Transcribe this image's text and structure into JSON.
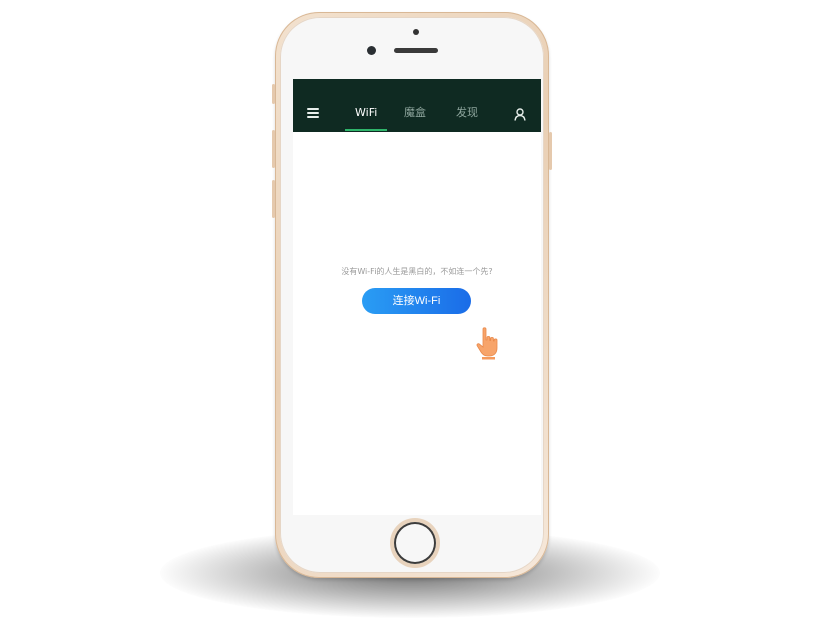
{
  "nav": {
    "tabs": [
      {
        "label": "WiFi",
        "active": true
      },
      {
        "label": "魔盒",
        "active": false
      },
      {
        "label": "发现",
        "active": false
      }
    ],
    "menu_icon": "hamburger-menu-icon",
    "user_icon": "user-profile-icon"
  },
  "main": {
    "hint": "没有Wi-Fi的人生是黑白的，不如连一个先?",
    "connect_button_label": "连接Wi-Fi"
  },
  "colors": {
    "topbar_bg": "#0f2a22",
    "tab_active": "#ffffff",
    "tab_inactive": "#8ea59d",
    "tab_indicator": "#2fb56b",
    "button_gradient_start": "#2a9df4",
    "button_gradient_end": "#1a6ce8",
    "pointer_hand": "#f7a46a"
  }
}
